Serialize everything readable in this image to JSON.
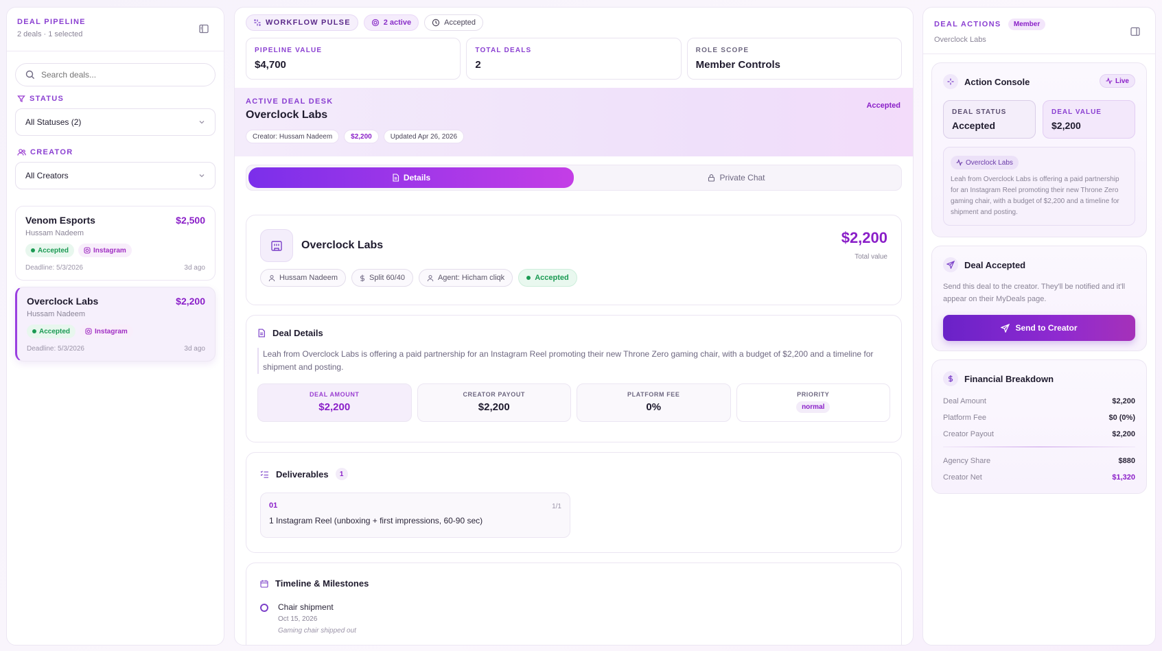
{
  "pipeline": {
    "title": "DEAL PIPELINE",
    "subtitle": "2 deals · 1 selected",
    "search_placeholder": "Search deals...",
    "status_label": "STATUS",
    "status_value": "All Statuses (2)",
    "creator_label": "CREATOR",
    "creator_value": "All Creators",
    "deals": [
      {
        "name": "Venom Esports",
        "amount": "$2,500",
        "creator": "Hussam Nadeem",
        "status": "Accepted",
        "platform": "Instagram",
        "deadline": "Deadline: 5/3/2026",
        "age": "3d ago"
      },
      {
        "name": "Overclock Labs",
        "amount": "$2,200",
        "creator": "Hussam Nadeem",
        "status": "Accepted",
        "platform": "Instagram",
        "deadline": "Deadline: 5/3/2026",
        "age": "3d ago"
      }
    ]
  },
  "pulse": {
    "label": "WORKFLOW PULSE",
    "active": "2 active",
    "status": "Accepted"
  },
  "metrics": [
    {
      "label": "PIPELINE VALUE",
      "value": "$4,700"
    },
    {
      "label": "TOTAL DEALS",
      "value": "2"
    },
    {
      "label": "ROLE SCOPE",
      "value": "Member Controls"
    }
  ],
  "desk": {
    "eyebrow": "ACTIVE DEAL DESK",
    "title": "Overclock Labs",
    "status": "Accepted",
    "creator": "Creator: Hussam Nadeem",
    "amount": "$2,200",
    "updated": "Updated Apr 26, 2026"
  },
  "tabs": {
    "details": "Details",
    "chat": "Private Chat"
  },
  "hero": {
    "name": "Overclock Labs",
    "amount": "$2,200",
    "amount_sub": "Total value",
    "creator": "Hussam Nadeem",
    "split": "Split 60/40",
    "agent": "Agent: Hicham cliqk",
    "status": "Accepted"
  },
  "details": {
    "title": "Deal Details",
    "description": "Leah from Overclock Labs is offering a paid partnership for an Instagram Reel promoting their new Throne Zero gaming chair, with a budget of $2,200 and a timeline for shipment and posting.",
    "stats": [
      {
        "label": "DEAL AMOUNT",
        "value": "$2,200"
      },
      {
        "label": "CREATOR PAYOUT",
        "value": "$2,200"
      },
      {
        "label": "PLATFORM FEE",
        "value": "0%"
      },
      {
        "label": "PRIORITY",
        "value": "normal"
      }
    ]
  },
  "deliverables": {
    "title": "Deliverables",
    "count": "1",
    "items": [
      {
        "num": "01",
        "frac": "1/1",
        "text": "1 Instagram Reel (unboxing + first impressions, 60-90 sec)"
      }
    ]
  },
  "timeline": {
    "title": "Timeline & Milestones",
    "items": [
      {
        "title": "Chair shipment",
        "date": "Oct 15, 2026",
        "note": "Gaming chair shipped out"
      }
    ]
  },
  "actions": {
    "title": "DEAL ACTIONS",
    "role": "Member",
    "subtitle": "Overclock Labs",
    "console_title": "Action Console",
    "live": "Live",
    "status_label": "DEAL STATUS",
    "status_value": "Accepted",
    "value_label": "DEAL VALUE",
    "value_value": "$2,200",
    "brief_chip": "Overclock Labs",
    "brief_text": "Leah from Overclock Labs is offering a paid partnership for an Instagram Reel promoting their new Throne Zero gaming chair, with a budget of $2,200 and a timeline for shipment and posting."
  },
  "accepted": {
    "title": "Deal Accepted",
    "text": "Send this deal to the creator. They'll be notified and it'll appear on their MyDeals page.",
    "button": "Send to Creator"
  },
  "financial": {
    "title": "Financial Breakdown",
    "rows": [
      {
        "label": "Deal Amount",
        "value": "$2,200"
      },
      {
        "label": "Platform Fee",
        "value": "$0 (0%)"
      },
      {
        "label": "Creator Payout",
        "value": "$2,200"
      }
    ],
    "rows2": [
      {
        "label": "Agency Share",
        "value": "$880"
      },
      {
        "label": "Creator Net",
        "value": "$1,320"
      }
    ]
  },
  "colors": {
    "accent": "#8a1fc8",
    "success": "#1b9a53",
    "brand_gradient_start": "#7b2fea",
    "brand_gradient_end": "#c43ee6"
  }
}
